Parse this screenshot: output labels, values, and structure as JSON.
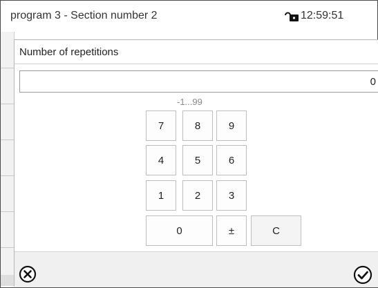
{
  "status": {
    "title": "program 3 - Section number 2",
    "time": "12:59:51",
    "lock_icon": "unlock-icon"
  },
  "dialog": {
    "title": "Number of repetitions",
    "value": "0",
    "range_hint": "-1...99",
    "keys": {
      "k7": "7",
      "k8": "8",
      "k9": "9",
      "k4": "4",
      "k5": "5",
      "k6": "6",
      "k1": "1",
      "k2": "2",
      "k3": "3",
      "k0": "0",
      "sign": "±",
      "clear": "C"
    },
    "cancel_icon": "cancel-circle-x-icon",
    "confirm_icon": "confirm-circle-check-icon"
  }
}
